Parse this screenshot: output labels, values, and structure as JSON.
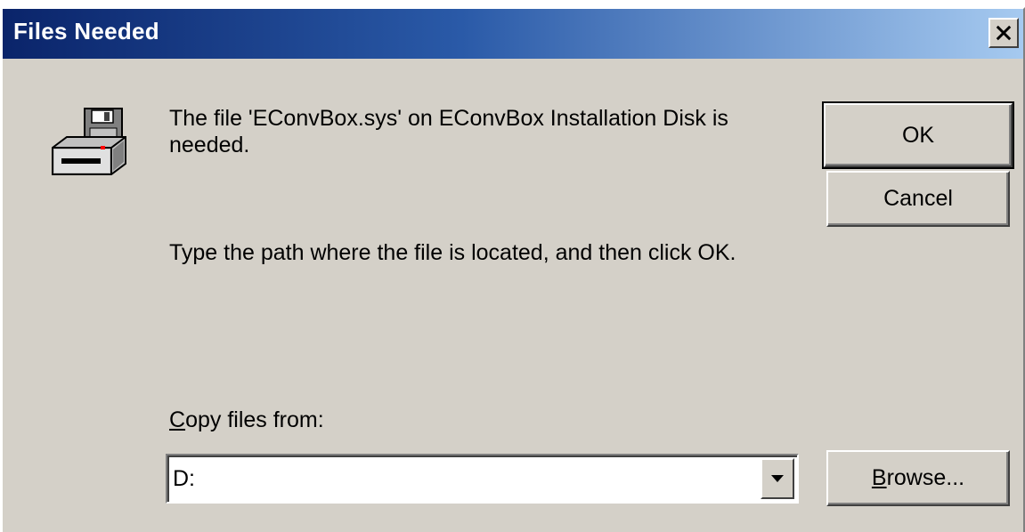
{
  "window": {
    "title": "Files Needed",
    "close_glyph": "×"
  },
  "message": {
    "line1": "The file 'EConvBox.sys' on EConvBox Installation Disk is needed.",
    "line2": "Type the path where the file is located, and then click OK."
  },
  "buttons": {
    "ok_label": "OK",
    "cancel_label": "Cancel",
    "browse_mnemonic": "B",
    "browse_rest": "rowse..."
  },
  "copy_from": {
    "label_mnemonic": "C",
    "label_rest": "opy files from:",
    "value": "D:"
  },
  "icons": {
    "dialog_icon": "disk-drive-icon",
    "close": "close-icon",
    "dropdown": "chevron-down-icon"
  },
  "colors": {
    "titlebar_start": "#0a246a",
    "titlebar_end": "#a6caf0",
    "face": "#d4d0c8"
  }
}
